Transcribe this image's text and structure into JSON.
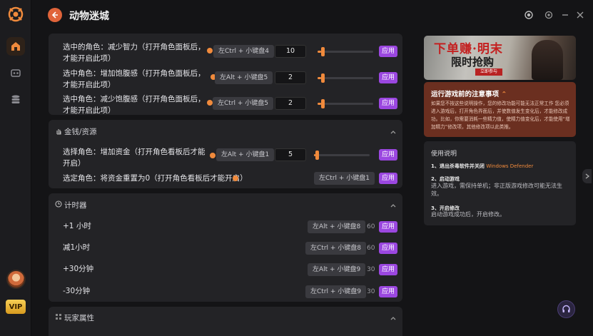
{
  "app": {
    "title": "动物迷城",
    "vip_label": "VIP"
  },
  "sections": {
    "top_rows": [
      {
        "label": "选中的角色：减少智力（打开角色面板后，才能开启此项）",
        "hotkey": "左Ctrl + 小键盘4",
        "value": "10",
        "slider": 0.06,
        "apply": "应用"
      },
      {
        "label": "选中角色：增加饱腹感（打开角色面板后，才能开启此项）",
        "hotkey": "左Alt + 小键盘5",
        "value": "2",
        "slider": 0.06,
        "apply": "应用"
      },
      {
        "label": "选中角色：减少饱腹感（打开角色面板后，才能开启此项）",
        "hotkey": "左Ctrl + 小键盘5",
        "value": "2",
        "slider": 0.06,
        "apply": "应用"
      }
    ],
    "money": {
      "title": "金钱/资源",
      "rows": [
        {
          "label": "选择角色：增加资金（打开角色看板后才能开启）",
          "hotkey": "左Alt + 小键盘1",
          "value": "5",
          "slider": 0.03,
          "apply": "应用"
        },
        {
          "label": "选定角色：将资金重置为0（打开角色看板后才能开启）",
          "hotkey": "左Ctrl + 小键盘1",
          "apply": "应用"
        }
      ]
    },
    "timer": {
      "title": "计时器",
      "rows": [
        {
          "label": "+1 小时",
          "hotkey": "左Alt + 小键盘8",
          "value": "60",
          "apply": "应用"
        },
        {
          "label": "减1小时",
          "hotkey": "左Ctrl + 小键盘8",
          "value": "60",
          "apply": "应用"
        },
        {
          "label": "+30分钟",
          "hotkey": "左Alt + 小键盘9",
          "value": "30",
          "apply": "应用"
        },
        {
          "label": "-30分钟",
          "hotkey": "左Ctrl + 小键盘9",
          "value": "30",
          "apply": "应用"
        }
      ]
    },
    "player": {
      "title": "玩家属性"
    }
  },
  "banner": {
    "title_line1": "下单赚·明末",
    "title_line2": "限时抢购",
    "stamp": "立即参与"
  },
  "notice": {
    "title": "运行游戏前的注意事项",
    "body": "如果您不按这些说明操作，您的修改功能可能无法正常工作 您必须进入游戏后，打开角色界面后，并使数值发生变化后，才能修改成功。比如，你需要消耗一些精力值，使精力值变化后，才能使用“增加精力”修改项，其他修改项以此类推。"
  },
  "usage": {
    "title": "使用说明",
    "step1_title": "1、退出杀毒软件并关闭",
    "step1_highlight": "Windows Defender",
    "step2_title": "2、启动游戏",
    "step2_body": "进入游戏，需保持单机；非正版游戏修改可能无法生效。",
    "step3_title": "3、开启修改",
    "step3_body": "启动游戏成功后，开启修改。"
  },
  "colors": {
    "accent": "#f08a3c",
    "apply": "#9b47e0",
    "notice_bg": "#6b2f20"
  }
}
